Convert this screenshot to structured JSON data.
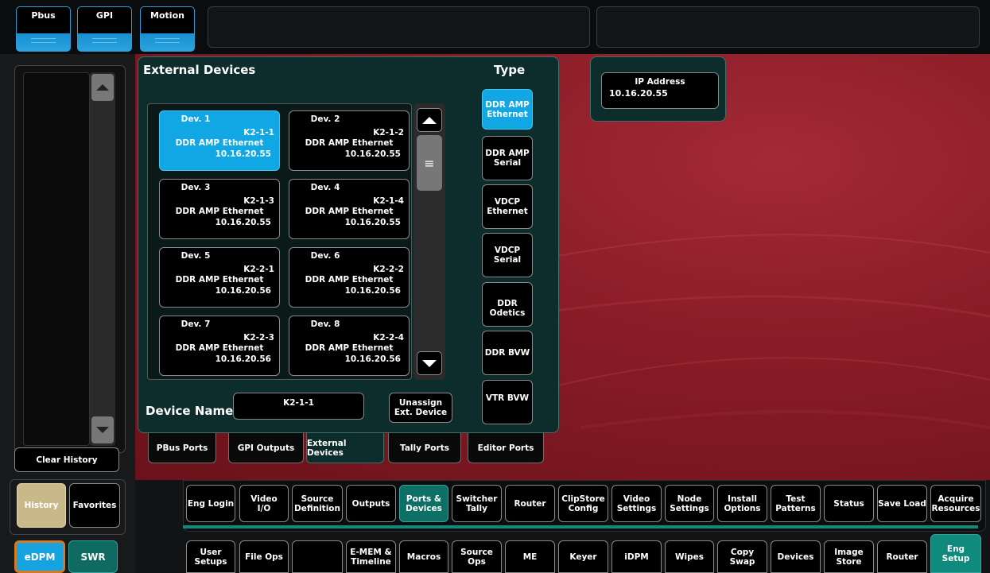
{
  "top_buttons": [
    "Pbus",
    "GPI",
    "Motion"
  ],
  "left": {
    "clear_history": "Clear History",
    "history": "History",
    "favorites": "Favorites",
    "edpm": "eDPM",
    "swr": "SWR"
  },
  "ext_panel": {
    "title": "External Devices",
    "type_label": "Type",
    "devices": [
      {
        "name": "Dev. 1",
        "id": "K2-1-1",
        "type": "DDR AMP Ethernet",
        "ip": "10.16.20.55"
      },
      {
        "name": "Dev. 2",
        "id": "K2-1-2",
        "type": "DDR AMP Ethernet",
        "ip": "10.16.20.55"
      },
      {
        "name": "Dev. 3",
        "id": "K2-1-3",
        "type": "DDR AMP Ethernet",
        "ip": "10.16.20.55"
      },
      {
        "name": "Dev. 4",
        "id": "K2-1-4",
        "type": "DDR AMP Ethernet",
        "ip": "10.16.20.55"
      },
      {
        "name": "Dev. 5",
        "id": "K2-2-1",
        "type": "DDR AMP Ethernet",
        "ip": "10.16.20.56"
      },
      {
        "name": "Dev. 6",
        "id": "K2-2-2",
        "type": "DDR AMP Ethernet",
        "ip": "10.16.20.56"
      },
      {
        "name": "Dev. 7",
        "id": "K2-2-3",
        "type": "DDR AMP Ethernet",
        "ip": "10.16.20.56"
      },
      {
        "name": "Dev. 8",
        "id": "K2-2-4",
        "type": "DDR AMP Ethernet",
        "ip": "10.16.20.56"
      }
    ],
    "types": [
      "DDR AMP\nEthernet",
      "DDR AMP\nSerial",
      "VDCP\nEthernet",
      "VDCP\nSerial",
      "DDR\nOdetics",
      "DDR BVW",
      "VTR BVW"
    ],
    "device_name_label": "Device Name",
    "device_name_value": "K2-1-1",
    "unassign": "Unassign\nExt. Device"
  },
  "ip_panel": {
    "label": "IP Address",
    "value": "10.16.20.55"
  },
  "tabs": [
    "PBus Ports",
    "GPI Outputs",
    "External Devices",
    "Tally Ports",
    "Editor Ports"
  ],
  "menu_row1": [
    "Eng Login",
    "Video\nI/O",
    "Source\nDefinition",
    "Outputs",
    "Ports &\nDevices",
    "Switcher\nTally",
    "Router",
    "ClipStore\nConfig",
    "Video\nSettings",
    "Node\nSettings",
    "Install\nOptions",
    "Test\nPatterns",
    "Status",
    "Save Load",
    "Acquire\nResources"
  ],
  "menu_row2": [
    "User\nSetups",
    "File Ops",
    "",
    "E-MEM &\nTimeline",
    "Macros",
    "Source\nOps",
    "ME",
    "Keyer",
    "iDPM",
    "Wipes",
    "Copy\nSwap",
    "Devices",
    "Image\nStore",
    "Router",
    "Eng\nSetup"
  ]
}
